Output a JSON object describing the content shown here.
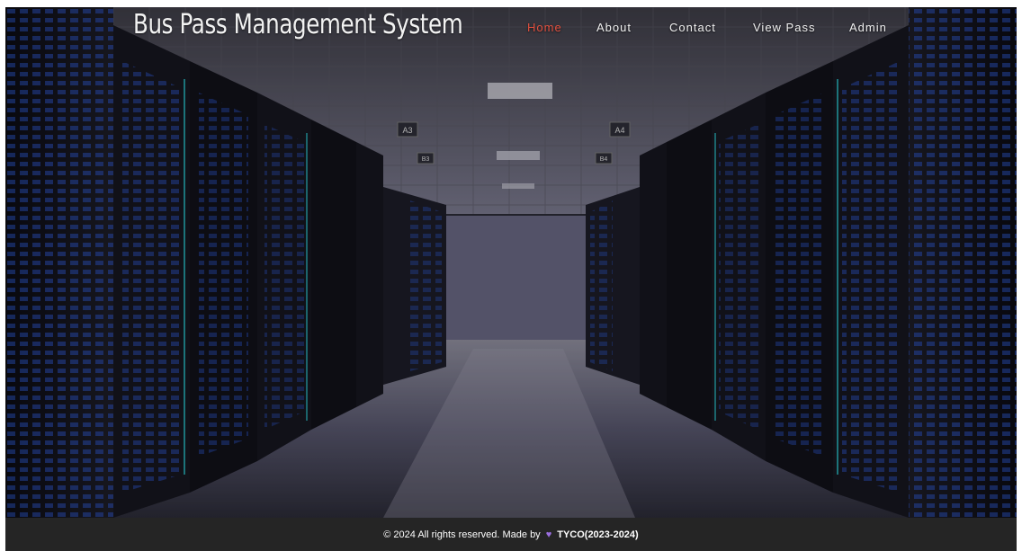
{
  "site": {
    "title": "Bus Pass Management System"
  },
  "nav": {
    "items": [
      {
        "label": "Home",
        "active": true
      },
      {
        "label": "About",
        "active": false
      },
      {
        "label": "Contact",
        "active": false
      },
      {
        "label": "View Pass",
        "active": false
      },
      {
        "label": "Admin",
        "active": false
      }
    ]
  },
  "hero": {
    "aisle_sign_labels": [
      "A3",
      "A4",
      "B3",
      "B4"
    ],
    "image_subject": "server-room-aisle"
  },
  "footer": {
    "copyright": "© 2024 All rights reserved. Made by",
    "heart_icon": "heart-icon",
    "org": "TYCO(2023-2024)"
  },
  "colors": {
    "active_nav": "#e2503f",
    "nav_text": "#f0f0f0",
    "footer_bg": "#252525",
    "heart": "#9b6fe0",
    "server_led": "#2f5bd8"
  }
}
